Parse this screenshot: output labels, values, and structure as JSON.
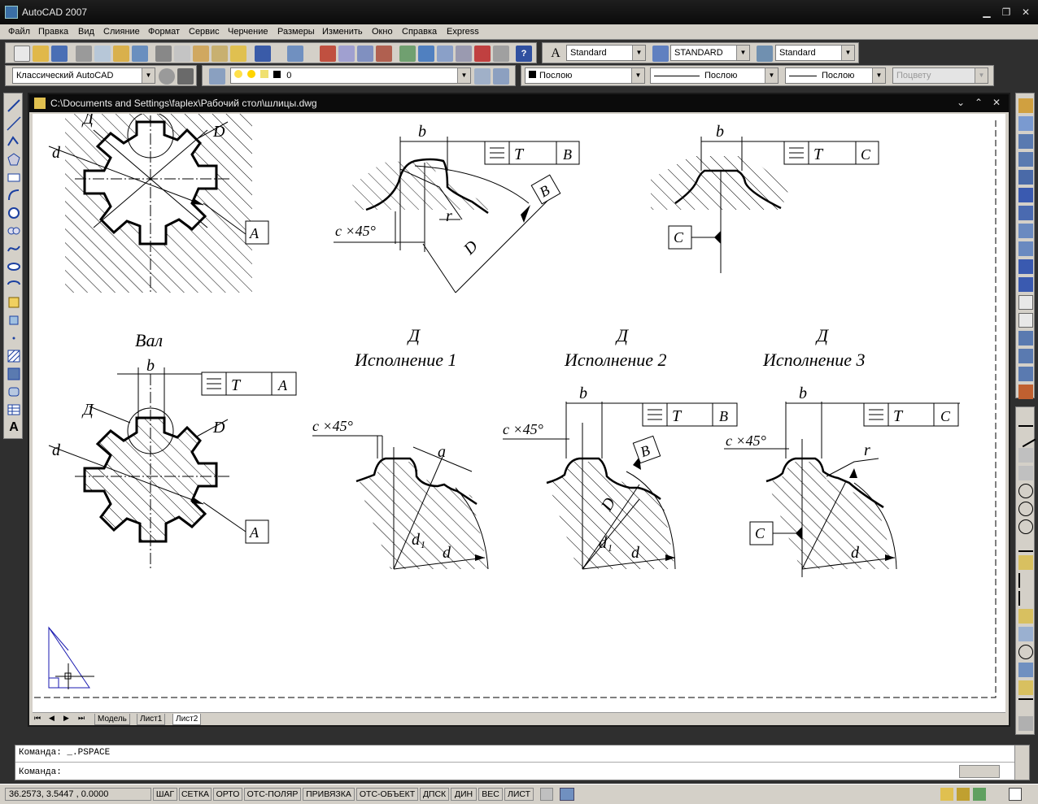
{
  "app": {
    "title": "AutoCAD 2007"
  },
  "menu": [
    "Файл",
    "Правка",
    "Вид",
    "Слияние",
    "Формат",
    "Сервис",
    "Черчение",
    "Размеры",
    "Изменить",
    "Окно",
    "Справка",
    "Express"
  ],
  "toolbar": {
    "text_style": "Standard",
    "dim_style": "STANDARD",
    "table_style": "Standard",
    "workspace": "Классический AutoCAD",
    "layer": "0",
    "color": "Послою",
    "linetype": "Послою",
    "lineweight": "Послою",
    "plotstyle": "Поцвету"
  },
  "document": {
    "title": "C:\\Documents and Settings\\faplex\\Рабочий стол\\шлицы.dwg",
    "tabs": [
      "Модель",
      "Лист1",
      "Лист2"
    ],
    "active_tab": "Лист2"
  },
  "drawing": {
    "labels": {
      "val": "Вал",
      "d_letter": "Д",
      "isp1": "Исполнение 1",
      "isp2": "Исполнение 2",
      "isp3": "Исполнение 3",
      "b": "b",
      "d": "d",
      "D": "D",
      "r": "r",
      "T": "T",
      "A": "A",
      "B": "B",
      "C": "C",
      "chamfer": "c ×45°",
      "a": "a",
      "d1": "d₁"
    }
  },
  "command": {
    "line1": "Команда:  _.PSPACE",
    "line2": "Команда:"
  },
  "status": {
    "coords": "36.2573, 3.5447 , 0.0000",
    "toggles": [
      "ШАГ",
      "СЕТКА",
      "ОРТО",
      "ОТС-ПОЛЯР",
      "ПРИВЯЗКА",
      "ОТС-ОБЪЕКТ",
      "ДПСК",
      "ДИН",
      "ВЕС",
      "ЛИСТ"
    ]
  }
}
